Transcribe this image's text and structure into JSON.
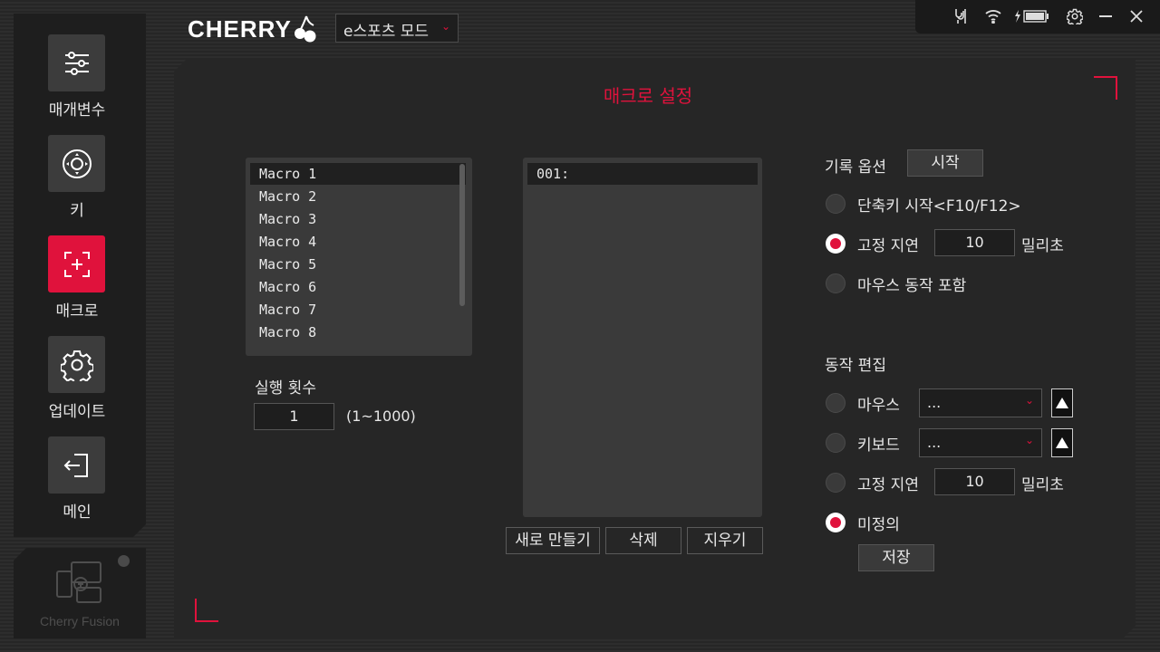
{
  "app": {
    "logo_text": "CHERRY",
    "mode_select": "e스포츠 모드"
  },
  "sidebar": {
    "items": [
      {
        "label": "매개변수",
        "icon": "sliders-icon",
        "active": false
      },
      {
        "label": "키",
        "icon": "joystick-icon",
        "active": false
      },
      {
        "label": "매크로",
        "icon": "macro-icon",
        "active": true
      },
      {
        "label": "업데이트",
        "icon": "gear-icon",
        "active": false
      },
      {
        "label": "메인",
        "icon": "exit-icon",
        "active": false
      }
    ],
    "fusion_label": "Cherry Fusion"
  },
  "topbar": {
    "icons": [
      "connection-icon",
      "wifi-icon",
      "battery-icon",
      "settings-icon",
      "minimize-icon",
      "close-icon"
    ]
  },
  "panel": {
    "title": "매크로 설정",
    "macros": [
      "Macro 1",
      "Macro 2",
      "Macro 3",
      "Macro 4",
      "Macro 5",
      "Macro 6",
      "Macro 7",
      "Macro 8"
    ],
    "selected_macro": "Macro 1",
    "run_count_label": "실행 횟수",
    "run_count_value": "1",
    "run_count_range": "(1~1000)",
    "actions": [
      "001:"
    ],
    "buttons": {
      "new": "새로 만들기",
      "delete": "삭제",
      "clear": "지우기"
    }
  },
  "record": {
    "label": "기록 옵션",
    "start_button": "시작",
    "hotkey_option": "단축키 시작<F10/F12>",
    "fixed_delay_label": "고정 지연",
    "fixed_delay_value": "10",
    "ms_unit": "밀리초",
    "include_mouse": "마우스 동작 포함",
    "selected": "fixed_delay"
  },
  "edit": {
    "label": "동작 편집",
    "mouse_label": "마우스",
    "mouse_value": "...",
    "keyboard_label": "키보드",
    "keyboard_value": "...",
    "fixed_delay_label": "고정 지연",
    "fixed_delay_value": "10",
    "ms_unit": "밀리초",
    "undefined_label": "미정의",
    "save_button": "저장",
    "selected": "undefined"
  },
  "colors": {
    "accent": "#e0123c",
    "panel": "#262626",
    "sidebar": "#1e1e1e"
  }
}
